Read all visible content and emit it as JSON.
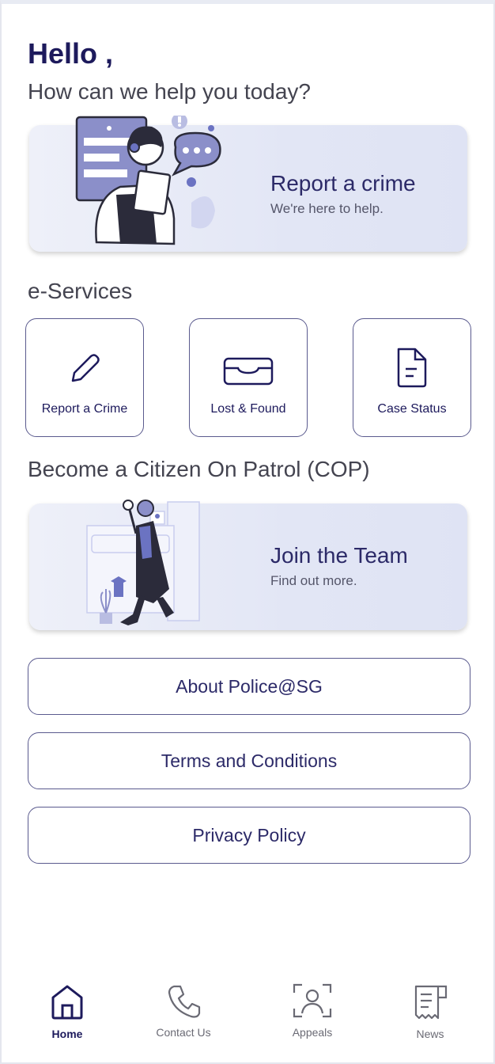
{
  "header": {
    "greeting": "Hello ,",
    "subtitle": "How can we help you today?"
  },
  "report_banner": {
    "title": "Report a crime",
    "subtitle": "We're here to help."
  },
  "eservices": {
    "title": "e-Services",
    "items": [
      {
        "label": "Report a Crime",
        "icon": "pencil-icon"
      },
      {
        "label": "Lost & Found",
        "icon": "tray-icon"
      },
      {
        "label": "Case Status",
        "icon": "document-icon"
      }
    ]
  },
  "cop": {
    "title": "Become a Citizen On Patrol (COP)",
    "banner_title": "Join the Team",
    "banner_subtitle": "Find out more."
  },
  "links": [
    {
      "label": "About Police@SG"
    },
    {
      "label": "Terms and Conditions"
    },
    {
      "label": "Privacy Policy"
    }
  ],
  "tabbar": {
    "active": "Home",
    "tabs": [
      {
        "label": "Home",
        "icon": "home-icon"
      },
      {
        "label": "Contact Us",
        "icon": "phone-icon"
      },
      {
        "label": "Appeals",
        "icon": "face-scan-icon"
      },
      {
        "label": "News",
        "icon": "newspaper-icon"
      }
    ]
  },
  "colors": {
    "brand": "#1d1a5c",
    "border": "#5a5a8e",
    "text": "#444450",
    "banner_bg": "#e2e6f5"
  }
}
